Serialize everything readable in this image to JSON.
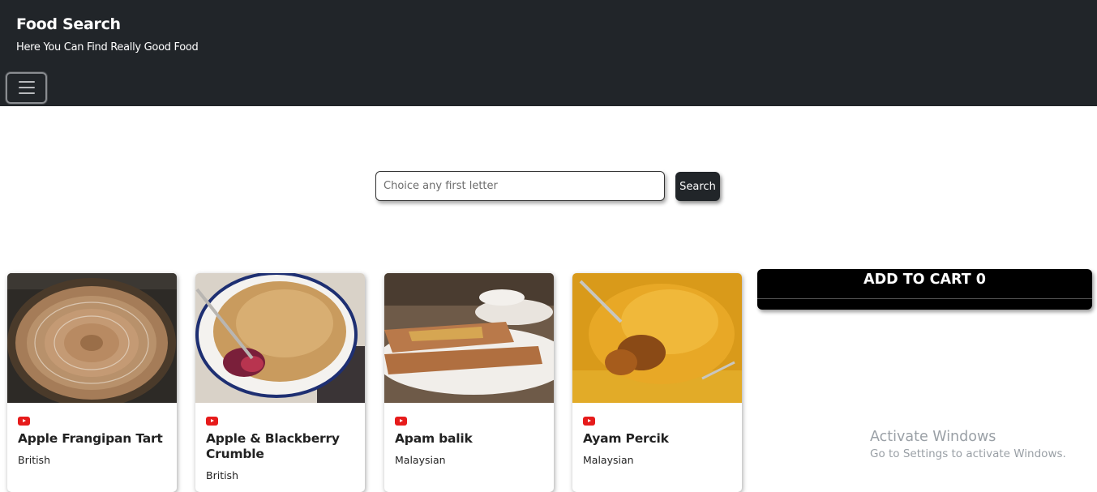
{
  "navbar": {
    "brand": "Food Search",
    "tagline": "Here You Can Find Really Good Food",
    "menu_icon": "hamburger-icon"
  },
  "search": {
    "placeholder": "Choice any first letter",
    "value": "",
    "button_label": "Search"
  },
  "meals": [
    {
      "name": "Apple Frangipan Tart",
      "area": "British",
      "video_icon": "youtube-icon"
    },
    {
      "name": "Apple & Blackberry Crumble",
      "area": "British",
      "video_icon": "youtube-icon"
    },
    {
      "name": "Apam balik",
      "area": "Malaysian",
      "video_icon": "youtube-icon"
    },
    {
      "name": "Ayam Percik",
      "area": "Malaysian",
      "video_icon": "youtube-icon"
    }
  ],
  "cart": {
    "label": "ADD TO CART 0"
  },
  "watermark": {
    "line1": "Activate Windows",
    "line2": "Go to Settings to activate Windows."
  },
  "colors": {
    "navbar_bg": "#212529",
    "cart_bg": "#000000",
    "youtube_red": "#e61b1b"
  }
}
